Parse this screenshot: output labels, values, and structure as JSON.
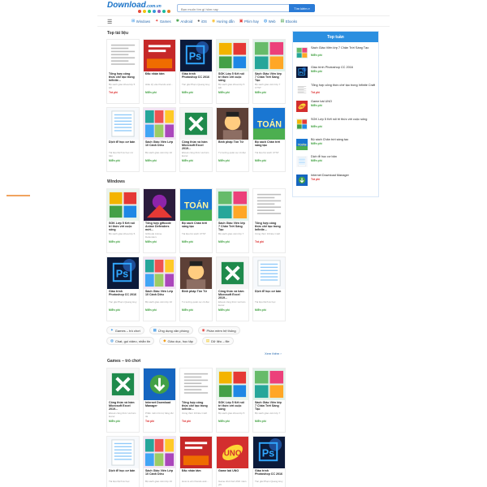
{
  "header": {
    "logo_main": "Download",
    "logo_tld": ".com.vn",
    "dot_colors": [
      "#e74c3c",
      "#f1c40f",
      "#2ecc71",
      "#3498db",
      "#9b59b6",
      "#1abc9c",
      "#e67e22"
    ],
    "search_placeholder": "Bạn muốn tìm gì hôm nay",
    "search_button": "Tìm kiếm"
  },
  "nav": {
    "items": [
      {
        "label": "Windows",
        "icon": "windows-icon",
        "glyph": "⊞",
        "color": "#1e88e5"
      },
      {
        "label": "Games",
        "icon": "gamepad-icon",
        "glyph": "✦",
        "color": "#e53935"
      },
      {
        "label": "Android",
        "icon": "android-icon",
        "glyph": "✱",
        "color": "#43a047"
      },
      {
        "label": "iOS",
        "icon": "apple-icon",
        "glyph": "●",
        "color": "#555"
      },
      {
        "label": "Hướng dẫn",
        "icon": "guide-icon",
        "glyph": "◉",
        "color": "#fbc02d"
      },
      {
        "label": "Phim hay",
        "icon": "film-icon",
        "glyph": "▣",
        "color": "#e53935"
      },
      {
        "label": "Web",
        "icon": "web-icon",
        "glyph": "◍",
        "color": "#1e88e5"
      },
      {
        "label": "Ebooks",
        "icon": "book-icon",
        "glyph": "▤",
        "color": "#43a047"
      }
    ]
  },
  "sections": {
    "top_tai_lieu": "Top tài liệu",
    "windows": "Windows",
    "games": "Games – trò chơi"
  },
  "cards_top": [
    {
      "title": "Tổng hợp công thức chế tạo trong Infinite...",
      "desc": "Bộ sách giáo khoa lớp 5 kết",
      "price": "Trả phí",
      "thumb": "doc"
    },
    {
      "title": "Đắc nhân tâm",
      "desc": "Hiểu kỹ vào friends and...",
      "price": "Miễn phí",
      "thumb": "book"
    },
    {
      "title": "Giáo trình Photoshop CC 2016",
      "desc": "Tác giả Phạm Quang Huy",
      "price": "Miễn phí",
      "thumb": "ps"
    },
    {
      "title": "SGK Lớp 5 Kết nối tri thức với cuộc sống",
      "desc": "Bộ sách giáo khoa lớp 5 kết",
      "price": "Miễn phí",
      "thumb": "sgk"
    },
    {
      "title": "Sách Giáo Viên lớp 7 Chân Trời Sáng Tạo",
      "desc": "Bộ sách giáo viên lớp 7 CTST",
      "price": "Miễn phí",
      "thumb": "sgv"
    },
    {
      "title": "Dịch tễ học cơ bản",
      "desc": "Tài liệu Dịch tễ học cơ bản",
      "price": "Miễn phí",
      "thumb": "plain"
    },
    {
      "title": "Sách Giáo Viên Lớp 10 Cánh Diều",
      "desc": "Bộ sách giáo viên lớp 10",
      "price": "Miễn phí",
      "thumb": "sgv2"
    },
    {
      "title": "Công thức và hàm Microsoft Excel 2019...",
      "desc": "Ebook công thức và hàm Excel",
      "price": "Miễn phí",
      "thumb": "xls"
    },
    {
      "title": "Binh pháp Tôn Tử",
      "desc": "Tư tưởng quân sự cổ đại",
      "price": "Miễn phí",
      "thumb": "face"
    },
    {
      "title": "Bộ sách Chân trời sáng tạo",
      "desc": "Tài liệu bộ sách CTST",
      "price": "Miễn phí",
      "thumb": "toan"
    }
  ],
  "cards_windows": [
    {
      "title": "SGK Lớp 5 Kết nối tri thức với cuộc sống",
      "desc": "Bộ sách giáo khoa lớp 5",
      "price": "Miễn phí",
      "thumb": "sgk"
    },
    {
      "title": "Tổng hợp giftcode Anime Defenders mới...",
      "desc": "Giftcode Anime Defenders",
      "price": "Miễn phí",
      "thumb": "anime"
    },
    {
      "title": "Bộ sách Chân trời sáng tạo",
      "desc": "Tài liệu bộ sách CTST",
      "price": "Miễn phí",
      "thumb": "toan"
    },
    {
      "title": "Sách Giáo Viên lớp 7 Chân Trời Sáng Tạo",
      "desc": "Bộ sách giáo viên lớp 7",
      "price": "Miễn phí",
      "thumb": "sgv"
    },
    {
      "title": "Tổng hợp công thức chế tạo trong Infinite...",
      "desc": "Công thức Infinite Craft",
      "price": "Trả phí",
      "thumb": "doc"
    },
    {
      "title": "Giáo trình Photoshop CC 2016",
      "desc": "Tác giả Phạm Quang Huy",
      "price": "Miễn phí",
      "thumb": "ps"
    },
    {
      "title": "Sách Giáo Viên Lớp 10 Cánh Diều",
      "desc": "Bộ sách giáo viên lớp 10",
      "price": "Miễn phí",
      "thumb": "sgv2"
    },
    {
      "title": "Binh pháp Tôn Tử",
      "desc": "Tư tưởng quân sự cổ đại",
      "price": "Miễn phí",
      "thumb": "face"
    },
    {
      "title": "Công thức và hàm Microsoft Excel 2019...",
      "desc": "Ebook công thức và hàm Excel",
      "price": "Miễn phí",
      "thumb": "xls"
    },
    {
      "title": "Dịch tễ học cơ bản",
      "desc": "Tài liệu Dịch tễ học",
      "price": "Miễn phí",
      "thumb": "plain"
    }
  ],
  "tags": [
    {
      "label": "Games – trò chơi",
      "glyph": "✦",
      "color": "#1e88e5"
    },
    {
      "label": "Ứng dụng văn phòng",
      "glyph": "▦",
      "color": "#1e88e5"
    },
    {
      "label": "Phần mềm hệ thống",
      "glyph": "◉",
      "color": "#e53935"
    },
    {
      "label": "Chat, gọi video, nhắn tin",
      "glyph": "◍",
      "color": "#1e88e5"
    },
    {
      "label": "Giáo dục, học tập",
      "glyph": "◆",
      "color": "#f39c12"
    },
    {
      "label": "Dữ liệu – file",
      "glyph": "▤",
      "color": "#f1c40f"
    }
  ],
  "more_label": "Xem thêm",
  "cards_games": [
    {
      "title": "Công thức và hàm Microsoft Excel 2019...",
      "desc": "Ebook công thức và hàm Excel",
      "price": "Miễn phí",
      "thumb": "xls"
    },
    {
      "title": "Internet Download Manager",
      "desc": "Phần mềm hỗ trợ tăng tốc tải",
      "price": "Trả phí",
      "thumb": "idm"
    },
    {
      "title": "Tổng hợp công thức chế tạo trong Infinite...",
      "desc": "Công thức Infinite Craft",
      "price": "Trả phí",
      "thumb": "doc"
    },
    {
      "title": "SGK Lớp 5 Kết nối tri thức với cuộc sống",
      "desc": "Bộ sách giáo khoa lớp 5",
      "price": "Miễn phí",
      "thumb": "sgk"
    },
    {
      "title": "Sách Giáo Viên lớp 7 Chân Trời Sáng Tạo",
      "desc": "Bộ sách giáo viên lớp 7",
      "price": "Miễn phí",
      "thumb": "sgv"
    },
    {
      "title": "Dịch tễ học cơ bản",
      "desc": "Tài liệu Dịch tễ học",
      "price": "Miễn phí",
      "thumb": "plain"
    },
    {
      "title": "Sách Giáo Viên Lớp 10 Cánh Diều",
      "desc": "Bộ sách giáo viên lớp 10",
      "price": "Miễn phí",
      "thumb": "sgv2"
    },
    {
      "title": "Đắc nhân tâm",
      "desc": "How to win friends and...",
      "price": "Miễn phí",
      "thumb": "book"
    },
    {
      "title": "Game bài UNO",
      "desc": "Game chơi bài UNO miễn phí",
      "price": "Miễn phí",
      "thumb": "uno"
    },
    {
      "title": "Giáo trình Photoshop CC 2016",
      "desc": "Tác giả Phạm Quang Huy",
      "price": "Miễn phí",
      "thumb": "ps"
    }
  ],
  "top_panel": {
    "title": "Top tuần",
    "items": [
      {
        "name": "Sách Giáo Viên lớp 7 Chân Trời Sáng Tạo",
        "price": "Miễn phí",
        "thumb": "sgv"
      },
      {
        "name": "Giáo trình Photoshop CC 2016",
        "price": "Miễn phí",
        "thumb": "ps"
      },
      {
        "name": "Tổng hợp công thức chế tạo trong Infinite Craft",
        "price": "Trả phí",
        "thumb": "doc"
      },
      {
        "name": "Game bài UNO",
        "price": "Miễn phí",
        "thumb": "uno"
      },
      {
        "name": "SGK Lớp 5 Kết nối tri thức với cuộc sống",
        "price": "Miễn phí",
        "thumb": "sgk"
      },
      {
        "name": "Bộ sách Chân trời sáng tạo",
        "price": "Miễn phí",
        "thumb": "toan"
      },
      {
        "name": "Dịch tễ học cơ bản",
        "price": "Miễn phí",
        "thumb": "plain"
      },
      {
        "name": "Internet Download Manager",
        "price": "Trả phí",
        "thumb": "idm"
      }
    ]
  }
}
